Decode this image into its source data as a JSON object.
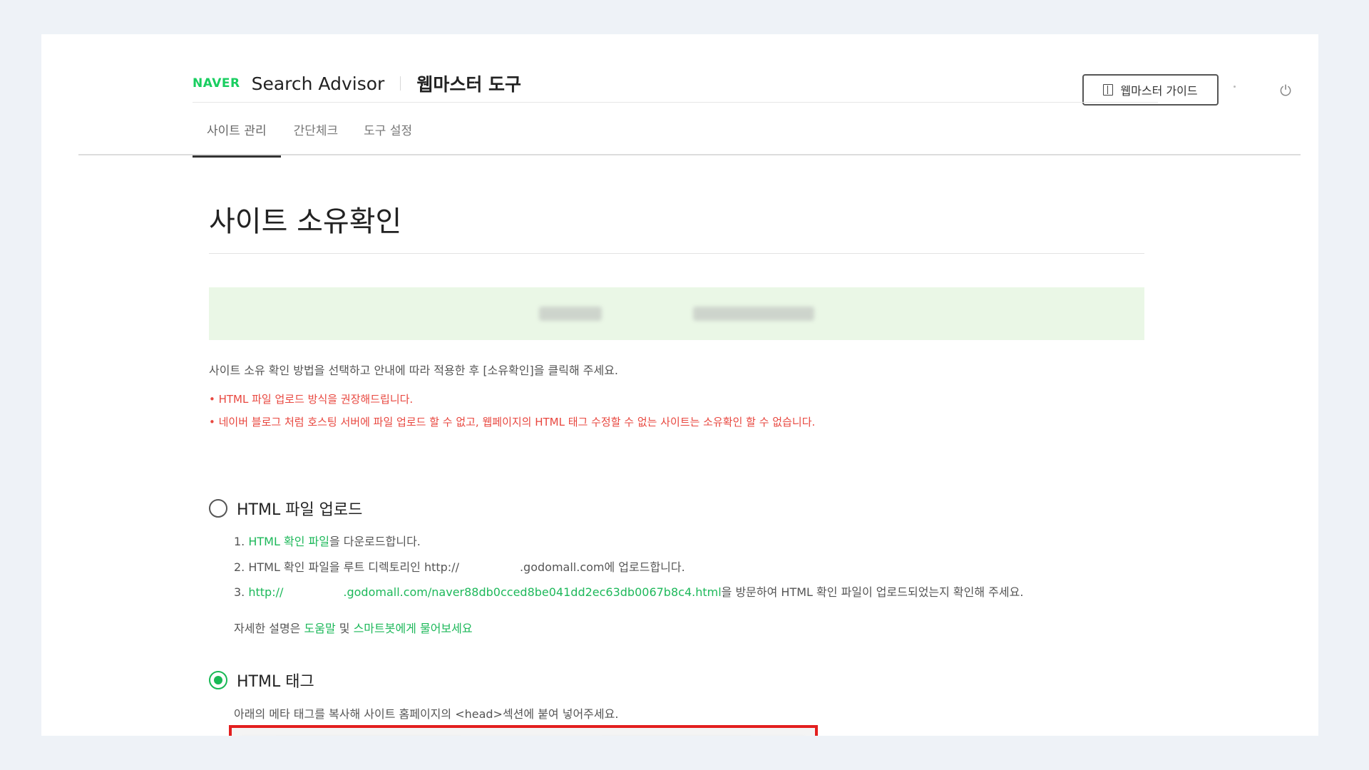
{
  "header": {
    "naver_logo": "NAVER",
    "product": "Search Advisor",
    "tool": "웹마스터 도구",
    "guide_button": "웹마스터 가이드"
  },
  "tabs": [
    {
      "label": "사이트 관리",
      "active": true
    },
    {
      "label": "간단체크",
      "active": false
    },
    {
      "label": "도구 설정",
      "active": false
    }
  ],
  "page": {
    "title": "사이트 소유확인",
    "guide_text": "사이트 소유 확인 방법을 선택하고 안내에 따라 적용한 후 [소유확인]을 클릭해 주세요.",
    "warnings": [
      "• HTML 파일 업로드 방식을 권장해드립니다.",
      "• 네이버 블로그 처럼 호스팅 서버에 파일 업로드 할 수 없고, 웹페이지의 HTML 태그 수정할 수 없는 사이트는 소유확인 할 수 없습니다."
    ]
  },
  "options": {
    "html_file": {
      "label": "HTML 파일 업로드",
      "selected": false,
      "step1_prefix": "1. ",
      "step1_link": "HTML 확인 파일",
      "step1_suffix": "을 다운로드합니다.",
      "step2_prefix": "2. HTML 확인 파일을 루트 디렉토리인 http://",
      "step2_suffix": ".godomall.com에 업로드합니다.",
      "step3_prefix": "3. ",
      "step3_link_a": "http://",
      "step3_link_b": ".godomall.com/naver88db0cced8be041dd2ec63db0067b8c4.html",
      "step3_suffix": "을 방문하여 HTML 확인 파일이 업로드되었는지 확인해 주세요.",
      "help_prefix": "자세한 설명은 ",
      "help_link1": "도움말",
      "help_mid": " 및 ",
      "help_link2": "스마트봇에게 물어보세요"
    },
    "html_tag": {
      "label": "HTML 태그",
      "selected": true,
      "desc": "아래의 메타 태그를 복사해 사이트 홈페이지의 <head>섹션에 붙여 넣어주세요."
    }
  },
  "colors": {
    "naver_green": "#19ce60",
    "warning_red": "#e8473f",
    "link_green": "#1db85a",
    "highlight_red": "#e31f1f",
    "site_bar_bg": "#eaf7e6"
  },
  "icons": {
    "guide": "book-icon",
    "logout": "power-icon"
  }
}
